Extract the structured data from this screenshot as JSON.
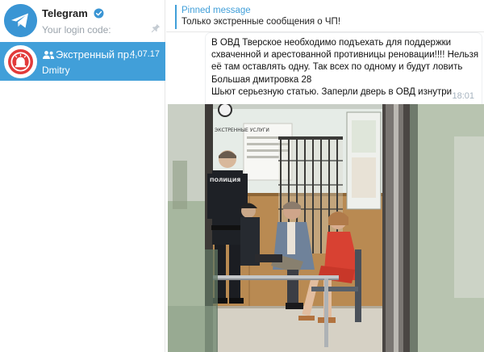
{
  "sidebar": {
    "chats": [
      {
        "title": "Telegram",
        "subtitle": "Your login code:",
        "verified": true,
        "pinned": true,
        "icon": "telegram-logo-icon",
        "selected": false
      },
      {
        "title": "Экстренный пр...",
        "date": "4.07.17",
        "subtitle": "Dmitry",
        "group": true,
        "icon": "alarm-siren-icon",
        "selected": true
      }
    ]
  },
  "pinned": {
    "label": "Pinned message",
    "text": "Только экстренные сообщения о ЧП!"
  },
  "message": {
    "lines": [
      "В ОВД Тверское необходимо подъехать для поддержки",
      "схваченной и арестованной противницы реновации!!!! Нельзя",
      "её там оставлять одну. Так всех по одному и будут ловить",
      "Большая дмитровка 28",
      "Шьют серьезную статью. Заперли дверь в ОВД изнутри"
    ],
    "time": "18:01",
    "photo_signs": {
      "police_back": "ПОЛИЦИЯ",
      "wall_sign": "ЭКСТРЕННЫЕ УСЛУГИ"
    }
  },
  "colors": {
    "accent": "#419fd9",
    "selected_bg": "#419fd9",
    "muted": "#9aa3ab"
  }
}
